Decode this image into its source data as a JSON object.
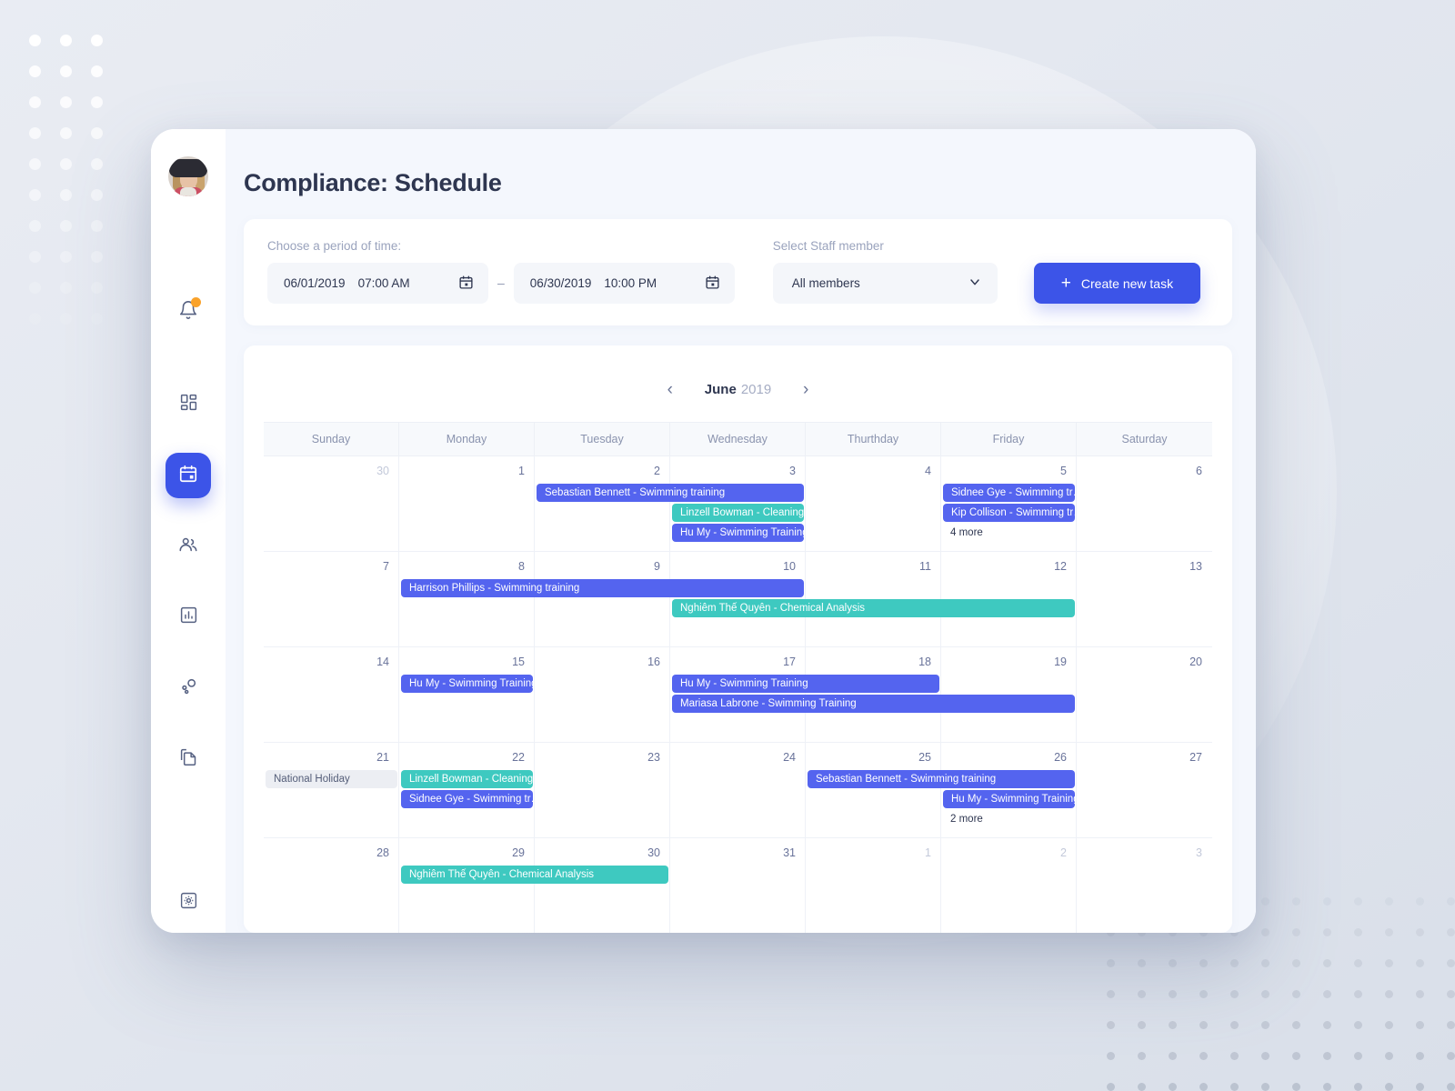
{
  "app": {
    "page_title": "Compliance: Schedule",
    "accent_color": "#3c54e8",
    "event_blue": "#5464ef",
    "event_teal": "#3ec9c0",
    "badge_color": "#f9a22b"
  },
  "sidebar": {
    "items": [
      {
        "icon": "avatar",
        "name": "user-avatar"
      },
      {
        "icon": "bell-icon",
        "name": "notifications",
        "badge": true
      },
      {
        "icon": "dashboard-icon",
        "name": "dashboard"
      },
      {
        "icon": "calendar-icon",
        "name": "schedule",
        "active": true
      },
      {
        "icon": "users-icon",
        "name": "staff"
      },
      {
        "icon": "bar-chart-icon",
        "name": "reports"
      },
      {
        "icon": "nodes-icon",
        "name": "integrations"
      },
      {
        "icon": "documents-icon",
        "name": "documents"
      },
      {
        "icon": "settings-icon",
        "name": "settings"
      }
    ]
  },
  "filters": {
    "period_label": "Choose a period of time:",
    "start_date": "06/01/2019",
    "start_time": "07:00 AM",
    "separator": "–",
    "end_date": "06/30/2019",
    "end_time": "10:00 PM",
    "staff_label": "Select Staff member",
    "staff_value": "All members",
    "staff_options": [
      "All members"
    ],
    "create_button": "Create new task",
    "create_plus": "+"
  },
  "calendar": {
    "prev_arrow": "‹",
    "next_arrow": "›",
    "month": "June",
    "year": "2019",
    "weekdays": [
      "Sunday",
      "Monday",
      "Tuesday",
      "Wednesday",
      "Thurthday",
      "Friday",
      "Saturday"
    ],
    "weeks": [
      {
        "days": [
          {
            "num": "30",
            "muted": true
          },
          {
            "num": "1"
          },
          {
            "num": "2"
          },
          {
            "num": "3"
          },
          {
            "num": "4"
          },
          {
            "num": "5"
          },
          {
            "num": "6"
          }
        ],
        "events": [
          {
            "label": "Sebastian Bennett - Swimming training",
            "color": "blue",
            "start": 2,
            "span": 2,
            "row": 0
          },
          {
            "label": "Linzell Bowman - Cleaning",
            "color": "teal",
            "start": 3,
            "span": 1,
            "row": 1
          },
          {
            "label": "Hu My - Swimming Training",
            "color": "blue",
            "start": 3,
            "span": 1,
            "row": 2
          },
          {
            "label": "Sidnee Gye - Swimming tr…",
            "color": "blue",
            "start": 5,
            "span": 1,
            "row": 0
          },
          {
            "label": "Kip Collison - Swimming tr…",
            "color": "blue",
            "start": 5,
            "span": 1,
            "row": 1
          }
        ],
        "more": [
          {
            "label": "4 more",
            "col": 5,
            "row": 2
          }
        ]
      },
      {
        "days": [
          {
            "num": "7"
          },
          {
            "num": "8"
          },
          {
            "num": "9"
          },
          {
            "num": "10"
          },
          {
            "num": "11"
          },
          {
            "num": "12"
          },
          {
            "num": "13"
          }
        ],
        "events": [
          {
            "label": "Harrison Phillips - Swimming training",
            "color": "blue",
            "start": 1,
            "span": 3,
            "row": 0
          },
          {
            "label": "Nghiêm Thế Quyên - Chemical Analysis",
            "color": "teal",
            "start": 3,
            "span": 3,
            "row": 1
          }
        ],
        "more": []
      },
      {
        "days": [
          {
            "num": "14"
          },
          {
            "num": "15"
          },
          {
            "num": "16"
          },
          {
            "num": "17"
          },
          {
            "num": "18"
          },
          {
            "num": "19"
          },
          {
            "num": "20"
          }
        ],
        "events": [
          {
            "label": "Hu My - Swimming Training",
            "color": "blue",
            "start": 1,
            "span": 1,
            "row": 0
          },
          {
            "label": "Hu My - Swimming Training",
            "color": "blue",
            "start": 3,
            "span": 2,
            "row": 0
          },
          {
            "label": "Mariasa Labrone - Swimming Training",
            "color": "blue",
            "start": 3,
            "span": 3,
            "row": 1
          }
        ],
        "more": []
      },
      {
        "days": [
          {
            "num": "21"
          },
          {
            "num": "22"
          },
          {
            "num": "23"
          },
          {
            "num": "24"
          },
          {
            "num": "25"
          },
          {
            "num": "26"
          },
          {
            "num": "27"
          }
        ],
        "events": [
          {
            "label": "National Holiday",
            "color": "grey",
            "start": 0,
            "span": 1,
            "row": 0
          },
          {
            "label": "Linzell Bowman - Cleaning",
            "color": "teal",
            "start": 1,
            "span": 1,
            "row": 0
          },
          {
            "label": "Sidnee Gye - Swimming tr…",
            "color": "blue",
            "start": 1,
            "span": 1,
            "row": 1
          },
          {
            "label": "Sebastian Bennett - Swimming training",
            "color": "blue",
            "start": 4,
            "span": 2,
            "row": 0
          },
          {
            "label": "Hu My - Swimming Training",
            "color": "blue",
            "start": 5,
            "span": 1,
            "row": 1
          }
        ],
        "more": [
          {
            "label": "2 more",
            "col": 5,
            "row": 2
          }
        ]
      },
      {
        "days": [
          {
            "num": "28"
          },
          {
            "num": "29"
          },
          {
            "num": "30"
          },
          {
            "num": "31"
          },
          {
            "num": "1",
            "muted": true
          },
          {
            "num": "2",
            "muted": true
          },
          {
            "num": "3",
            "muted": true
          }
        ],
        "events": [
          {
            "label": "Nghiêm Thế Quyên - Chemical Analysis",
            "color": "teal",
            "start": 1,
            "span": 2,
            "row": 0
          }
        ],
        "more": []
      }
    ]
  }
}
